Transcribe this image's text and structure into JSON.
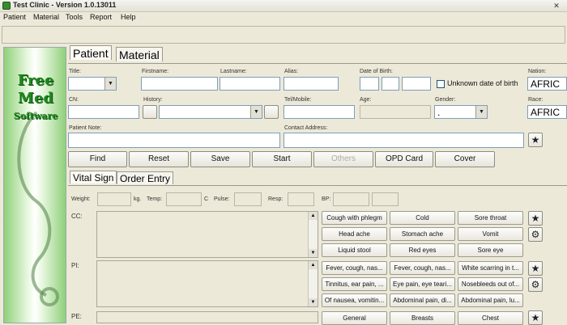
{
  "window": {
    "title": "Test Clinic - Version 1.0.13011"
  },
  "menu": [
    "Patient",
    "Material",
    "Tools",
    "Report",
    "Help"
  ],
  "logo": {
    "line1": "Free",
    "line2": "Med",
    "line3": "Software"
  },
  "main_tabs": [
    "Patient",
    "Material"
  ],
  "patient_form": {
    "title_label": "Title:",
    "firstname_label": "Firstname:",
    "lastname_label": "Lastname:",
    "alias_label": "Alias:",
    "dob_label": "Date of Birth:",
    "unknown_dob_label": "Unknown date of birth",
    "nation_label": "Nation:",
    "nation_value": "AFRIC",
    "cn_label": "CN:",
    "history_label": "History:",
    "tel_label": "Tel/Mobile:",
    "age_label": "Age:",
    "gender_label": "Gender:",
    "gender_value": ".",
    "race_label": "Race:",
    "race_value": "AFRIC",
    "note_label": "Patient Note:",
    "address_label": "Contact Address:"
  },
  "actions": {
    "find": "Find",
    "reset": "Reset",
    "save": "Save",
    "start": "Start",
    "others": "Others",
    "opd_card": "OPD Card",
    "cover": "Cover"
  },
  "sub_tabs": [
    "Vital Sign",
    "Order Entry"
  ],
  "vitals": {
    "weight_label": "Weight:",
    "kg_label": "kg.",
    "temp_label": "Temp:",
    "c_label": "C",
    "pulse_label": "Pulse:",
    "resp_label": "Resp:",
    "bp_label": "BP:"
  },
  "sections": {
    "cc": "CC:",
    "pi": "PI:",
    "pe": "PE:"
  },
  "cc_quick": [
    "Cough with phlegm",
    "Cold",
    "Sore throat",
    "Head ache",
    "Stomach ache",
    "Vomit",
    "Liquid stool",
    "Red eyes",
    "Sore eye"
  ],
  "pi_quick": [
    "Fever, cough, nas...",
    "Fever, cough, nas...",
    "White scarring in t...",
    "Tinnitus, ear pain, ...",
    "Eye pain, eye teari...",
    "Nosebleeds out of...",
    "Of nausea, vomitin...",
    "Abdominal pain, di...",
    "Abdominal pain, lu..."
  ],
  "pe_quick": [
    "General",
    "Breasts",
    "Chest"
  ],
  "icons": {
    "star": "star-icon",
    "gear": "gear-icon"
  }
}
